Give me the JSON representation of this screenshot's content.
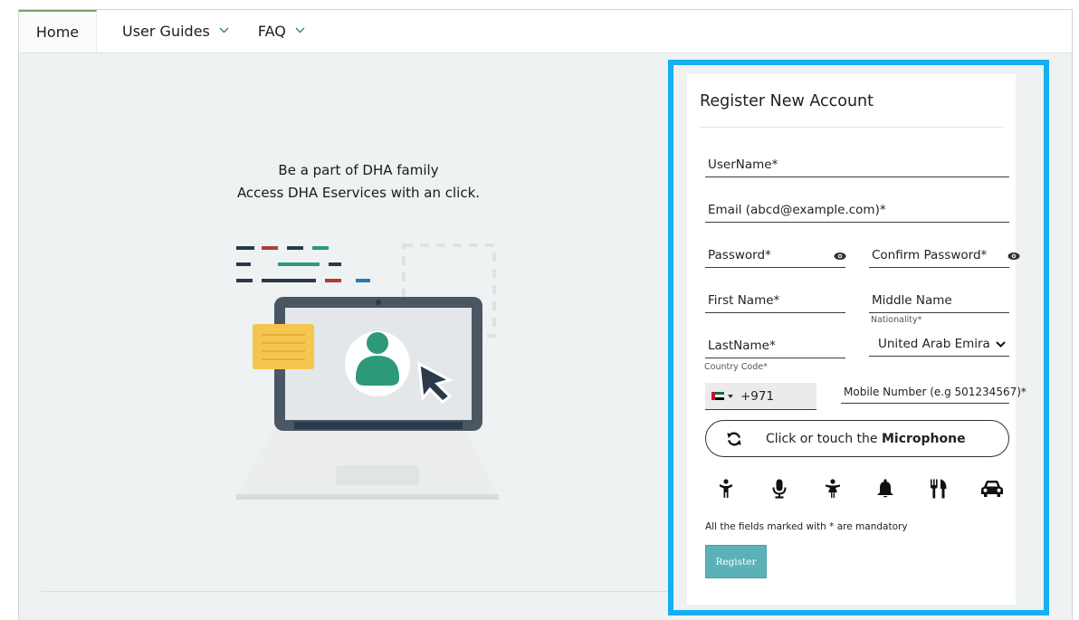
{
  "nav": {
    "items": [
      {
        "label": "Home"
      },
      {
        "label": "User Guides"
      },
      {
        "label": "FAQ"
      }
    ]
  },
  "hero": {
    "line1": "Be a part of DHA family",
    "line2": "Access DHA Eservices with an click."
  },
  "form": {
    "title": "Register New Account",
    "username_label": "UserName*",
    "email_label": "Email (abcd@example.com)*",
    "password_label": "Password*",
    "confirm_password_label": "Confirm Password*",
    "first_name_label": "First Name*",
    "middle_name_label": "Middle Name",
    "nationality_caption": "Nationality*",
    "nationality_value": "United Arab Emirates",
    "last_name_label": "LastName*",
    "country_code_caption": "Country Code*",
    "country_code_value": "+971",
    "mobile_label": "Mobile Number (e.g 501234567)*",
    "captcha_prefix": "Click or touch the ",
    "captcha_bold": "Microphone",
    "captcha_icons": [
      "child-icon",
      "microphone-icon",
      "female-icon",
      "bell-icon",
      "cutlery-icon",
      "car-icon"
    ],
    "mandatory_note": "All the fields marked with * are mandatory",
    "register_label": "Register"
  },
  "colors": {
    "panel_border": "#16aff0",
    "register_button": "#5bb1b7",
    "page_background": "#eef2f2"
  }
}
